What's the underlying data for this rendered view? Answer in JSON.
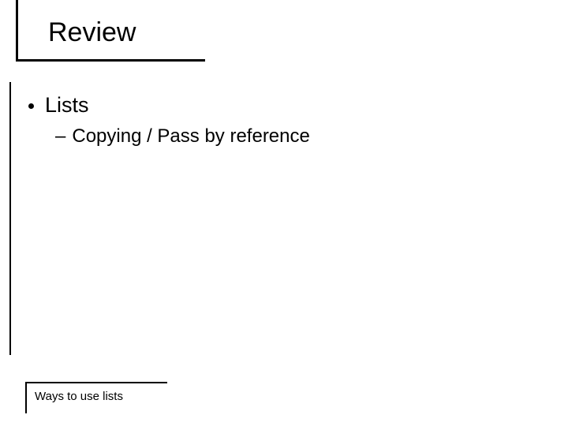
{
  "title": "Review",
  "body": {
    "level1": "Lists",
    "level2": "Copying / Pass by reference"
  },
  "footer": "Ways to use lists"
}
